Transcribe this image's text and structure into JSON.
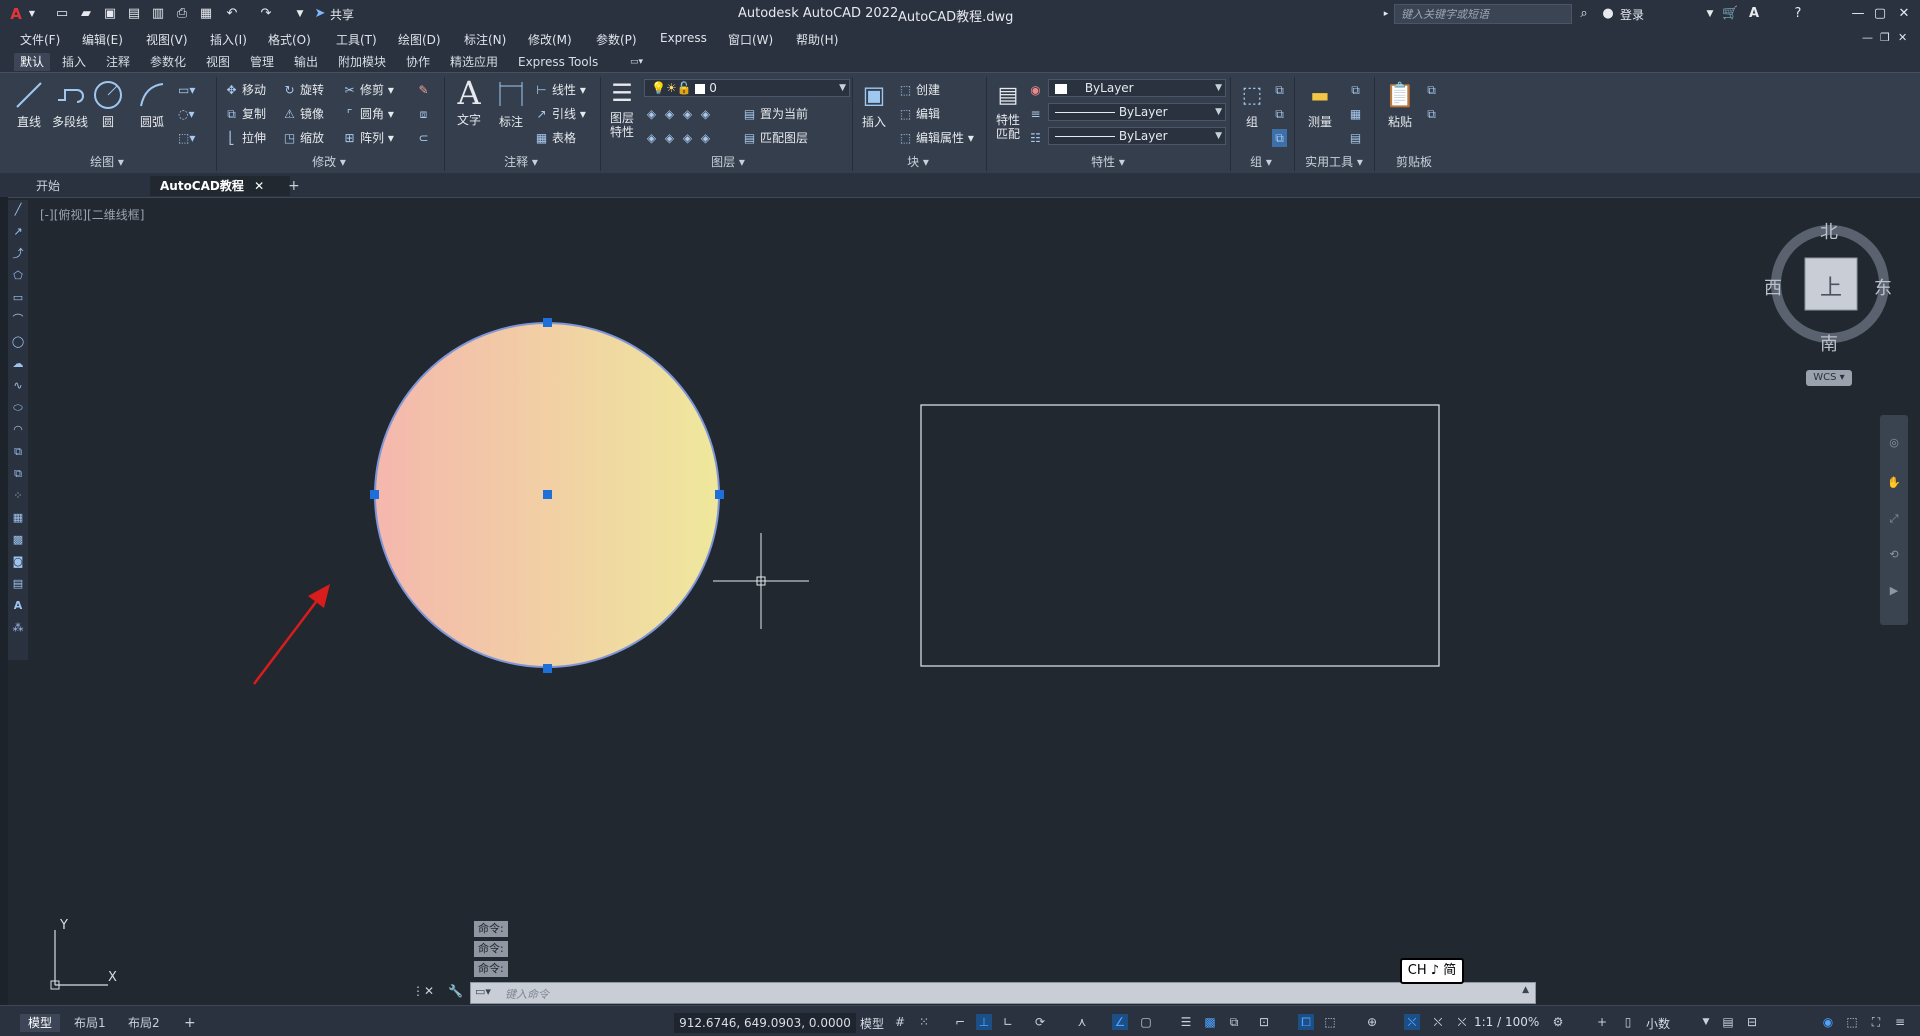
{
  "titlebar": {
    "app_title": "Autodesk AutoCAD 2022",
    "file_name": "AutoCAD教程.dwg",
    "share_label": "共享",
    "search_placeholder": "键入关键字或短语",
    "login_label": "登录"
  },
  "menu": [
    "文件(F)",
    "编辑(E)",
    "视图(V)",
    "插入(I)",
    "格式(O)",
    "工具(T)",
    "绘图(D)",
    "标注(N)",
    "修改(M)",
    "参数(P)",
    "Express",
    "窗口(W)",
    "帮助(H)"
  ],
  "ribbon_tabs": [
    "默认",
    "插入",
    "注释",
    "参数化",
    "视图",
    "管理",
    "输出",
    "附加模块",
    "协作",
    "精选应用",
    "Express Tools"
  ],
  "ribbon": {
    "draw": {
      "title": "绘图",
      "line": "直线",
      "polyline": "多段线",
      "circle": "圆",
      "arc": "圆弧"
    },
    "modify": {
      "title": "修改",
      "move": "移动",
      "rotate": "旋转",
      "trim": "修剪",
      "copy": "复制",
      "mirror": "镜像",
      "fillet": "圆角",
      "stretch": "拉伸",
      "scale": "缩放",
      "array": "阵列"
    },
    "annotation": {
      "title": "注释",
      "text": "文字",
      "dimension": "标注",
      "linear": "线性",
      "leader": "引线",
      "table": "表格"
    },
    "layers": {
      "title": "图层",
      "layer_props": "图层特性",
      "layer_props_line2": "特性",
      "layer_props_line1": "图层",
      "current_layer": "0",
      "set_current": "置为当前",
      "match_layer": "匹配图层"
    },
    "block": {
      "title": "块",
      "insert": "插入",
      "create": "创建",
      "edit": "编辑",
      "edit_attr": "编辑属性"
    },
    "properties": {
      "title": "特性",
      "match_line1": "特性",
      "match_line2": "匹配",
      "color": "ByLayer",
      "linetype": "ByLayer",
      "lineweight": "ByLayer"
    },
    "groups": {
      "title": "组",
      "group": "组"
    },
    "utilities": {
      "title": "实用工具",
      "measure": "测量"
    },
    "clipboard": {
      "title": "剪贴板",
      "paste": "粘贴"
    }
  },
  "doc_tabs": {
    "start": "开始",
    "active": "AutoCAD教程"
  },
  "viewport": {
    "label": "[-][俯视][二维线框]",
    "viewcube": {
      "north": "北",
      "south": "南",
      "east": "东",
      "west": "西",
      "top": "上",
      "wcs": "WCS"
    },
    "ucs": {
      "x": "X",
      "y": "Y"
    }
  },
  "command": {
    "history": [
      "命令:",
      "命令:",
      "命令:"
    ],
    "placeholder": "键入命令"
  },
  "ime": "CH ♪ 简",
  "status": {
    "layouts": [
      "模型",
      "布局1",
      "布局2"
    ],
    "coords": "912.6746, 649.0903, 0.0000",
    "model_label": "模型",
    "scale": "1:1 / 100%",
    "units": "小数"
  },
  "colors": {
    "canvas_bg": "#212830",
    "gradient_left": "#f4b7ad",
    "gradient_right": "#efe89c",
    "grip_blue": "#1e6fd9",
    "arrow_red": "#d91c1c"
  }
}
